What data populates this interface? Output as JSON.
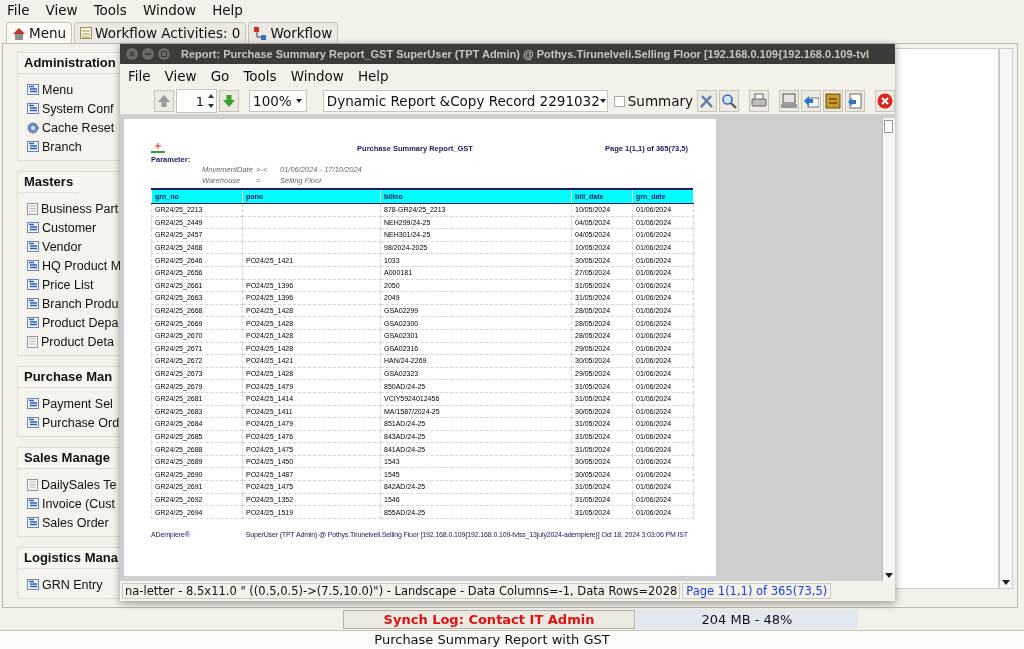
{
  "menu_bar": [
    "File",
    "View",
    "Tools",
    "Window",
    "Help"
  ],
  "tabs": [
    {
      "label": "Menu",
      "kind": "home",
      "selected": true
    },
    {
      "label": "Workflow Activities: 0",
      "kind": "list",
      "selected": false
    },
    {
      "label": "Workflow",
      "kind": "flow",
      "selected": false
    }
  ],
  "sidebar": {
    "sections": [
      {
        "title": "Administration",
        "items": [
          {
            "label": "Menu",
            "kind": "window"
          },
          {
            "label": "System Conf",
            "kind": "window"
          },
          {
            "label": "Cache Reset",
            "kind": "process"
          },
          {
            "label": "Branch",
            "kind": "window"
          }
        ]
      },
      {
        "title": "Masters",
        "items": [
          {
            "label": "Business Part",
            "kind": "report"
          },
          {
            "label": "Customer",
            "kind": "window"
          },
          {
            "label": "Vendor",
            "kind": "window"
          },
          {
            "label": "HQ Product M",
            "kind": "window"
          },
          {
            "label": "Price List",
            "kind": "window"
          },
          {
            "label": "Branch Produ",
            "kind": "window"
          },
          {
            "label": "Product Depa",
            "kind": "window"
          },
          {
            "label": "Product Deta",
            "kind": "report"
          }
        ]
      },
      {
        "title": "Purchase Man",
        "items": [
          {
            "label": "Payment Sel",
            "kind": "window"
          },
          {
            "label": "Purchase Ord",
            "kind": "window"
          }
        ]
      },
      {
        "title": "Sales Manage",
        "items": [
          {
            "label": "DailySales Te",
            "kind": "report"
          },
          {
            "label": "Invoice (Cust",
            "kind": "window"
          },
          {
            "label": "Sales Order",
            "kind": "window"
          }
        ]
      },
      {
        "title": "Logistics Mana",
        "items": [
          {
            "label": "GRN Entry",
            "kind": "window"
          }
        ]
      }
    ]
  },
  "report_window": {
    "title": "Report: Purchase Summary Report_GST  SuperUser (TPT Admin) @ Pothys.Tirunelveli.Selling Floor [192.168.0.109{192.168.0.109-tvl",
    "menu_bar": [
      "File",
      "View",
      "Go",
      "Tools",
      "Window",
      "Help"
    ],
    "toolbar": {
      "page_number": "1",
      "zoom": "100%",
      "report_format": "Dynamic Report &Copy Record 2291032",
      "summary": {
        "label": "Summary",
        "checked": false
      }
    },
    "report": {
      "title": "Purchase Summary Report_GST",
      "page": "Page 1(1,1) of 365(73,5)",
      "parameter_label": "Parameter:",
      "parameters": [
        {
          "name": "MovementDate",
          "operator": ">-<",
          "value": "01/06/2024 - 17/10/2024"
        },
        {
          "name": "Warehouse",
          "operator": "=",
          "value": "Selling Floor"
        }
      ],
      "columns": [
        "grn_no",
        "pono",
        "billno",
        "bill_date",
        "grn_date"
      ],
      "rows": [
        {
          "grn_no": "GR24/25_2213",
          "billno": "878-GR24/25_2213",
          "bill_date": "10/05/2024",
          "grn_date": "01/06/2024"
        },
        {
          "grn_no": "GR24/25_2449",
          "billno": "NEH299/24-25",
          "bill_date": "04/05/2024",
          "grn_date": "01/06/2024"
        },
        {
          "grn_no": "GR24/25_2457",
          "billno": "NEH301/24-25",
          "bill_date": "04/05/2024",
          "grn_date": "01/06/2024"
        },
        {
          "grn_no": "GR24/25_2468",
          "billno": "98/2024-2025",
          "bill_date": "10/05/2024",
          "grn_date": "01/06/2024"
        },
        {
          "grn_no": "GR24/25_2646",
          "pono": "PO24/25_1421",
          "billno": "1033",
          "bill_date": "30/05/2024",
          "grn_date": "01/06/2024"
        },
        {
          "grn_no": "GR24/25_2656",
          "billno": "A000181",
          "bill_date": "27/05/2024",
          "grn_date": "01/06/2024"
        },
        {
          "grn_no": "GR24/25_2661",
          "pono": "PO24/25_1396",
          "billno": "2050",
          "bill_date": "31/05/2024",
          "grn_date": "01/06/2024"
        },
        {
          "grn_no": "GR24/25_2663",
          "pono": "PO24/25_1396",
          "billno": "2049",
          "bill_date": "31/05/2024",
          "grn_date": "01/06/2024"
        },
        {
          "grn_no": "GR24/25_2668",
          "pono": "PO24/25_1428",
          "billno": "GSA02299",
          "bill_date": "28/05/2024",
          "grn_date": "01/06/2024"
        },
        {
          "grn_no": "GR24/25_2669",
          "pono": "PO24/25_1428",
          "billno": "GSA02300",
          "bill_date": "28/05/2024",
          "grn_date": "01/06/2024"
        },
        {
          "grn_no": "GR24/25_2670",
          "pono": "PO24/25_1428",
          "billno": "GSA02301",
          "bill_date": "28/05/2024",
          "grn_date": "01/06/2024"
        },
        {
          "grn_no": "GR24/25_2671",
          "pono": "PO24/25_1428",
          "billno": "GSA02316",
          "bill_date": "29/05/2024",
          "grn_date": "01/06/2024"
        },
        {
          "grn_no": "GR24/25_2672",
          "pono": "PO24/25_1421",
          "billno": "HAN/24-2269",
          "bill_date": "30/05/2024",
          "grn_date": "01/06/2024"
        },
        {
          "grn_no": "GR24/25_2673",
          "pono": "PO24/25_1428",
          "billno": "GSA02323",
          "bill_date": "29/05/2024",
          "grn_date": "01/06/2024"
        },
        {
          "grn_no": "GR24/25_2679",
          "pono": "PO24/25_1479",
          "billno": "850AD/24-25",
          "bill_date": "31/05/2024",
          "grn_date": "01/06/2024"
        },
        {
          "grn_no": "GR24/25_2681",
          "pono": "PO24/25_1414",
          "billno": "VCIY5924012456",
          "bill_date": "31/05/2024",
          "grn_date": "01/06/2024"
        },
        {
          "grn_no": "GR24/25_2683",
          "pono": "PO24/25_1411",
          "billno": "MA/1587/2024-25",
          "bill_date": "30/05/2024",
          "grn_date": "01/06/2024"
        },
        {
          "grn_no": "GR24/25_2684",
          "pono": "PO24/25_1479",
          "billno": "851AD/24-25",
          "bill_date": "31/05/2024",
          "grn_date": "01/06/2024"
        },
        {
          "grn_no": "GR24/25_2685",
          "pono": "PO24/25_1476",
          "billno": "843AD/24-25",
          "bill_date": "31/05/2024",
          "grn_date": "01/06/2024"
        },
        {
          "grn_no": "GR24/25_2688",
          "pono": "PO24/25_1475",
          "billno": "841AD/24-25",
          "bill_date": "31/05/2024",
          "grn_date": "01/06/2024"
        },
        {
          "grn_no": "GR24/25_2689",
          "pono": "PO24/25_1450",
          "billno": "1543",
          "bill_date": "30/05/2024",
          "grn_date": "01/06/2024"
        },
        {
          "grn_no": "GR24/25_2690",
          "pono": "PO24/25_1487",
          "billno": "1545",
          "bill_date": "30/05/2024",
          "grn_date": "01/06/2024"
        },
        {
          "grn_no": "GR24/25_2691",
          "pono": "PO24/25_1475",
          "billno": "842AD/24-25",
          "bill_date": "31/05/2024",
          "grn_date": "01/06/2024"
        },
        {
          "grn_no": "GR24/25_2692",
          "pono": "PO24/25_1352",
          "billno": "1546",
          "bill_date": "31/05/2024",
          "grn_date": "01/06/2024"
        },
        {
          "grn_no": "GR24/25_2694",
          "pono": "PO24/25_1519",
          "billno": "855AD/24-25",
          "bill_date": "31/05/2024",
          "grn_date": "01/06/2024"
        }
      ],
      "footer_left": "ADempiere®",
      "footer_right": "SuperUser (TPT Admin) @ Pothys.Tirunelveli.Selling Floor [192.168.0.109{192.168.0.109-tvlss_13july2024-adempiere}] Oct 18, 2024 3:03:06 PM IST"
    },
    "status_left": "na-letter - 8.5x11.0 \" ((0.5,0.5)->(7.5,10.0)\") - Landscape - Data Columns=-1, Data Rows=2028",
    "status_right": "Page 1(1,1) of 365(73,5)"
  },
  "status": {
    "sync_log": "Synch Log: Contact IT Admin",
    "memory": "204 MB - 48%",
    "message": "Purchase Summary Report with GST"
  }
}
